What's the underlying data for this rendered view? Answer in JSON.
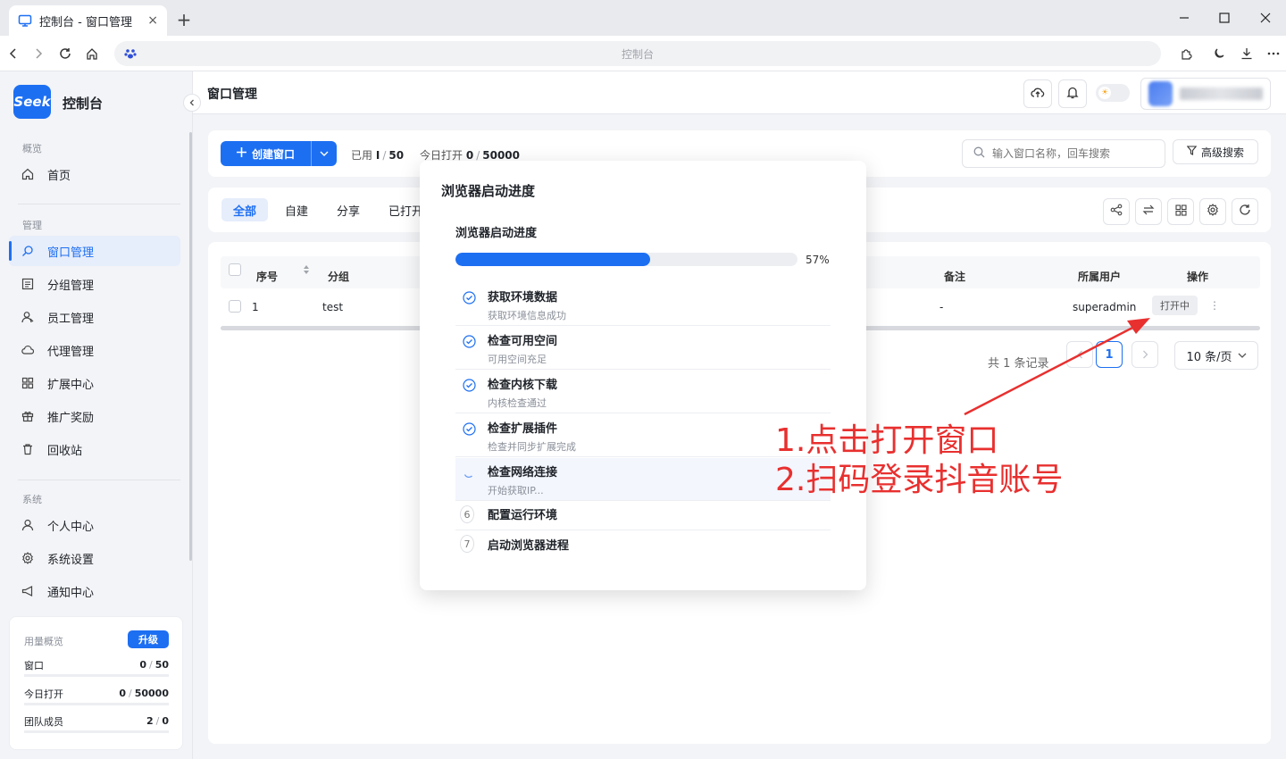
{
  "browser": {
    "tab_title": "控制台 - 窗口管理",
    "tab_close": "×",
    "new_tab": "+",
    "url_text": "控制台"
  },
  "sidebar": {
    "brand_logo": "Seek",
    "brand_name": "控制台",
    "sections": {
      "overview": "概览",
      "manage": "管理",
      "system": "系统"
    },
    "items": [
      {
        "label": "首页",
        "icon": "home-icon"
      },
      {
        "label": "窗口管理",
        "icon": "search-window-icon",
        "active": true
      },
      {
        "label": "分组管理",
        "icon": "group-icon"
      },
      {
        "label": "员工管理",
        "icon": "staff-icon"
      },
      {
        "label": "代理管理",
        "icon": "cloud-icon"
      },
      {
        "label": "扩展中心",
        "icon": "grid-icon"
      },
      {
        "label": "推广奖励",
        "icon": "gift-icon"
      },
      {
        "label": "回收站",
        "icon": "trash-icon"
      },
      {
        "label": "个人中心",
        "icon": "user-icon"
      },
      {
        "label": "系统设置",
        "icon": "gear-icon"
      },
      {
        "label": "通知中心",
        "icon": "megaphone-icon"
      }
    ],
    "usage": {
      "title": "用量概览",
      "upgrade": "升级",
      "rows": [
        {
          "label": "窗口",
          "used": "0",
          "total": "50"
        },
        {
          "label": "今日打开",
          "used": "0",
          "total": "50000"
        },
        {
          "label": "团队成员",
          "used": "2",
          "total": "0"
        }
      ]
    }
  },
  "header": {
    "page_title": "窗口管理"
  },
  "toolbar": {
    "create_label": "创建窗口",
    "used_label": "已用",
    "used_value": "I",
    "used_total": "50",
    "today_label": "今日打开",
    "today_value": "0",
    "today_total": "50000",
    "search_placeholder": "输入窗口名称，回车搜索",
    "advanced_search": "高级搜索"
  },
  "filter_tabs": [
    "全部",
    "自建",
    "分享",
    "已打开"
  ],
  "table": {
    "headers": {
      "index": "序号",
      "group": "分组",
      "remark": "备注",
      "owner": "所属用户",
      "action": "操作"
    },
    "rows": [
      {
        "index": "1",
        "group": "test",
        "remark": "-",
        "owner": "superadmin",
        "status": "打开中",
        "more": "⋮"
      }
    ]
  },
  "pagination": {
    "total_text": "共 1 条记录",
    "current_page": "1",
    "page_size": "10 条/页"
  },
  "modal": {
    "title": "浏览器启动进度",
    "progress_label": "浏览器启动进度",
    "progress_percent": 57,
    "progress_text": "57%",
    "steps": [
      {
        "title": "获取环境数据",
        "subtitle": "获取环境信息成功",
        "state": "done"
      },
      {
        "title": "检查可用空间",
        "subtitle": "可用空间充足",
        "state": "done"
      },
      {
        "title": "检查内核下载",
        "subtitle": "内核检查通过",
        "state": "done"
      },
      {
        "title": "检查扩展插件",
        "subtitle": "检查并同步扩展完成",
        "state": "done"
      },
      {
        "title": "检查网络连接",
        "subtitle": "开始获取IP...",
        "state": "running"
      },
      {
        "title": "配置运行环境",
        "number": "6",
        "state": "pending"
      },
      {
        "title": "启动浏览器进程",
        "number": "7",
        "state": "pending"
      }
    ]
  },
  "annotation": {
    "line1": "1.点击打开窗口",
    "line2": "2.扫码登录抖音账号",
    "color": "#e8302f"
  },
  "colors": {
    "accent": "#1d6ff2",
    "annotation": "#e8302f"
  }
}
